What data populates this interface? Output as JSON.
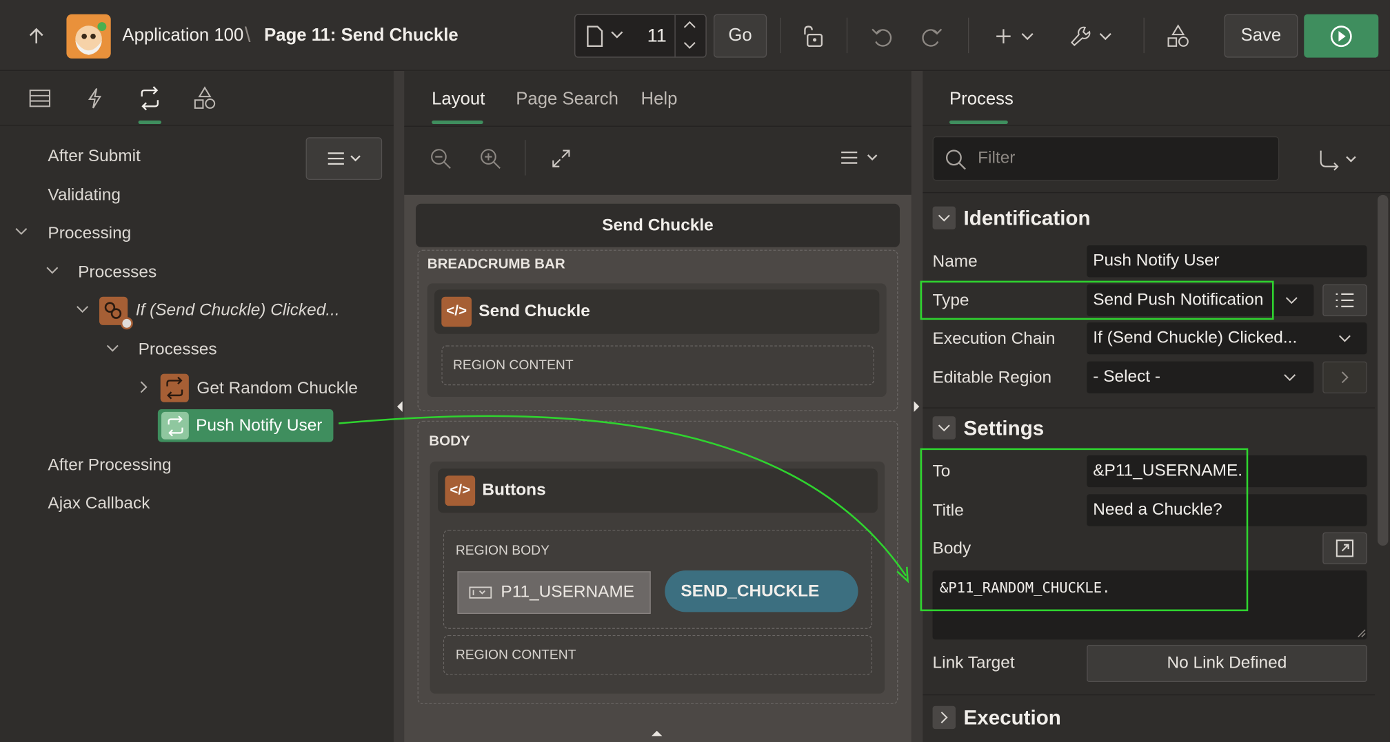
{
  "header": {
    "app_name": "Application 100",
    "page_name": "Page 11: Send Chuckle",
    "page_number": "11",
    "go_label": "Go",
    "save_label": "Save"
  },
  "left_panel": {
    "items": {
      "after_submit": "After Submit",
      "validating": "Validating",
      "processing": "Processing",
      "processes": "Processes",
      "if_clicked": "If (Send Chuckle) Clicked...",
      "sub_processes": "Processes",
      "get_random": "Get Random Chuckle",
      "push_notify": "Push Notify User",
      "after_processing": "After Processing",
      "ajax_callback": "Ajax Callback"
    }
  },
  "center_panel": {
    "tabs": [
      "Layout",
      "Page Search",
      "Help"
    ],
    "page_title": "Send Chuckle",
    "breadcrumb_bar": "BREADCRUMB BAR",
    "breadcrumb_region": "Send Chuckle",
    "region_content_1": "REGION CONTENT",
    "body": "BODY",
    "buttons_region": "Buttons",
    "region_body": "REGION BODY",
    "item_name": "P11_USERNAME",
    "button_name": "SEND_CHUCKLE",
    "region_content_2": "REGION CONTENT"
  },
  "right_panel": {
    "tab": "Process",
    "filter_placeholder": "Filter",
    "identification": {
      "title": "Identification",
      "name_label": "Name",
      "name_value": "Push Notify User",
      "type_label": "Type",
      "type_value": "Send Push Notification",
      "chain_label": "Execution Chain",
      "chain_value": "If (Send Chuckle) Clicked...",
      "editable_label": "Editable Region",
      "editable_value": "- Select -"
    },
    "settings": {
      "title": "Settings",
      "to_label": "To",
      "to_value": "&P11_USERNAME.",
      "title_label": "Title",
      "title_value": "Need a Chuckle?",
      "body_label": "Body",
      "body_value": "&P11_RANDOM_CHUCKLE.",
      "link_label": "Link Target",
      "link_value": "No Link Defined"
    },
    "execution": {
      "title": "Execution"
    }
  },
  "colors": {
    "accent_green": "#3f8e5e",
    "highlight_green": "#2fd42f",
    "process_orange": "#a65f35",
    "button_teal": "#3c6f80"
  }
}
